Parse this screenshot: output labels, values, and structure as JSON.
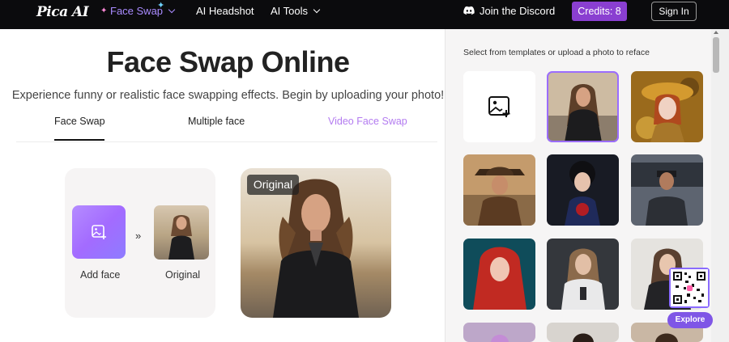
{
  "nav": {
    "logo": "Pica AI",
    "face_swap": "Face Swap",
    "ai_headshot": "AI Headshot",
    "ai_tools": "AI Tools",
    "discord": "Join the Discord",
    "credits": "Credits: 8",
    "sign_in": "Sign In"
  },
  "main": {
    "title": "Face Swap Online",
    "subtitle": "Experience funny or realistic face swapping effects. Begin by uploading your photo!",
    "tabs": [
      "Face Swap",
      "Multiple face",
      "Video Face Swap"
    ],
    "add_face": "Add face",
    "original": "Original",
    "badge": "Original",
    "arrows": "»"
  },
  "panel": {
    "title": "Select from templates or upload a photo to reface",
    "explore": "Explore"
  },
  "colors": {
    "accent": "#8a3fd1",
    "tab_video": "#b37bf0",
    "nav_active": "#a98bff"
  }
}
